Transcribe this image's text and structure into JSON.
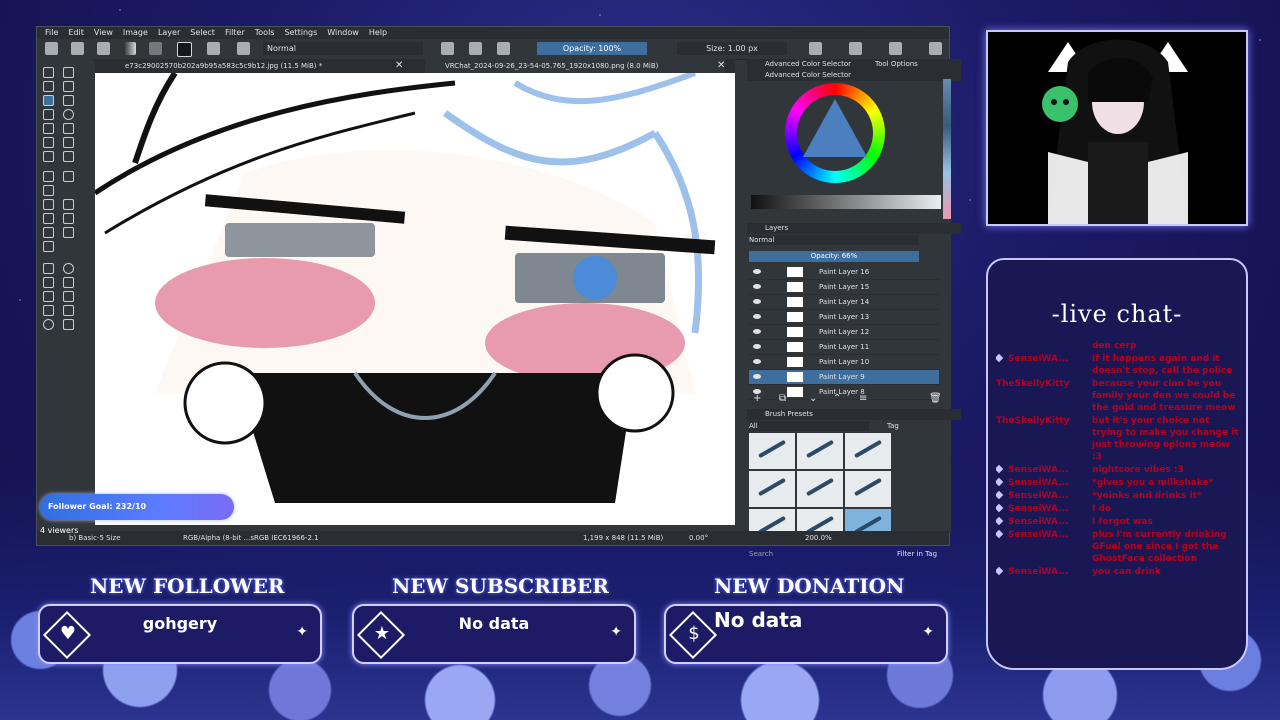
{
  "krita": {
    "menu": [
      "File",
      "Edit",
      "View",
      "Image",
      "Layer",
      "Select",
      "Filter",
      "Tools",
      "Settings",
      "Window",
      "Help"
    ],
    "blend_mode": "Normal",
    "opacity_label": "Opacity: 100%",
    "size_label": "Size: 1.00 px",
    "tabs": [
      {
        "label": "e73c29002570b202a9b95a583c5c9b12.jpg (11.5 MiB) *"
      },
      {
        "label": "VRChat_2024-09-26_23-54-05.765_1920x1080.png (8.0 MiB)"
      }
    ],
    "status": {
      "brush": "b) Basic-5 Size",
      "color_model": "RGB/Alpha (8-bit ...sRGB IEC61966-2.1",
      "dimensions": "1,199 x 848 (11.5 MiB)",
      "rotation": "0.00°",
      "zoom": "200.0%"
    },
    "dockers": {
      "advanced_color_selector_tab": "Advanced Color Selector",
      "tool_options_tab": "Tool Options",
      "advanced_color_selector_title": "Advanced Color Selector",
      "layers_title": "Layers",
      "layers_blend": "Normal",
      "layers_opacity": "Opacity:  66%",
      "layers": [
        {
          "name": "Paint Layer 16",
          "active": false
        },
        {
          "name": "Paint Layer 15",
          "active": false
        },
        {
          "name": "Paint Layer 14",
          "active": false
        },
        {
          "name": "Paint Layer 13",
          "active": false
        },
        {
          "name": "Paint Layer 12",
          "active": false
        },
        {
          "name": "Paint Layer 11",
          "active": false
        },
        {
          "name": "Paint Layer 10",
          "active": false
        },
        {
          "name": "Paint Layer 9",
          "active": true
        },
        {
          "name": "Paint Layer 8",
          "active": false
        }
      ],
      "brush_presets_title": "Brush Presets",
      "brush_filter": "All",
      "brush_tag": "Tag",
      "search_placeholder": "Search",
      "filter_in_tag": "Filter in Tag"
    }
  },
  "overlay": {
    "follower_goal": "Follower Goal: 232/10",
    "viewers": "4 viewers"
  },
  "chat": {
    "title": "-live chat-",
    "messages": [
      {
        "user": "",
        "text": "den cerp"
      },
      {
        "user": "SenseiWA...",
        "text": "if it happens again and it doesn't stop, call the police"
      },
      {
        "user": "TheSkellyKitty",
        "text": "because your clan be you family your den we could be the gold and treasure meow"
      },
      {
        "user": "TheSkellyKitty",
        "text": "but it's your choice not trying to make you change it just throwing oplons meow :3"
      },
      {
        "user": "SenseiWA...",
        "text": "nightcore vibes :3"
      },
      {
        "user": "SenseiWA...",
        "text": "*gives you a milkshake*"
      },
      {
        "user": "SenseiWA...",
        "text": "*yoinks and drinks it*"
      },
      {
        "user": "SenseiWA...",
        "text": "I do"
      },
      {
        "user": "SenseiWA...",
        "text": "I forgot was"
      },
      {
        "user": "SenseiWA...",
        "text": "plus I'm currently drinking GFuel one since I got the GhostFace collection"
      },
      {
        "user": "SenseiWA...",
        "text": "you can drink"
      }
    ]
  },
  "alerts": {
    "follower": {
      "title": "NEW FOLLOWER",
      "value": "gohgery",
      "icon": "heart-icon"
    },
    "subscriber": {
      "title": "NEW SUBSCRIBER",
      "value": "No data",
      "icon": "star-icon"
    },
    "donation": {
      "title": "NEW DONATION",
      "value": "No data",
      "icon": "dollar-icon"
    }
  },
  "colors": {
    "accent": "#3d6e9e",
    "chat_user": "#b8001a",
    "panel_bg": "#1e1b66"
  }
}
